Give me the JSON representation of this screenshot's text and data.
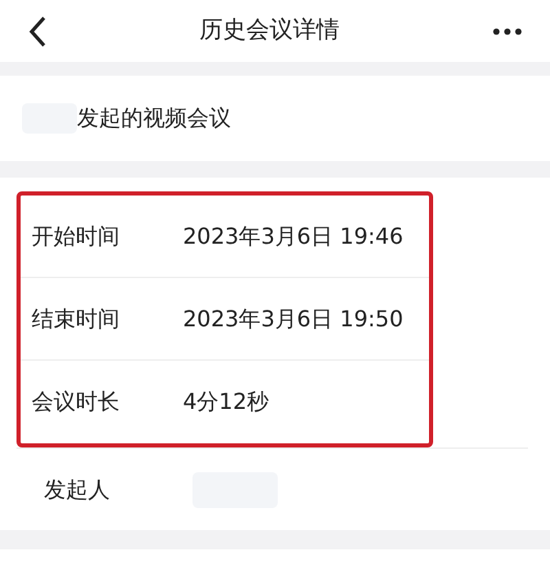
{
  "header": {
    "title": "历史会议详情"
  },
  "meeting": {
    "subtitle": "发起的视频会议"
  },
  "details": [
    {
      "label": "开始时间",
      "value": "2023年3月6日 19:46",
      "highlighted": true
    },
    {
      "label": "结束时间",
      "value": "2023年3月6日 19:50",
      "highlighted": true
    },
    {
      "label": "会议时长",
      "value": "4分12秒",
      "highlighted": true
    },
    {
      "label": "发起人",
      "highlighted": false
    }
  ]
}
